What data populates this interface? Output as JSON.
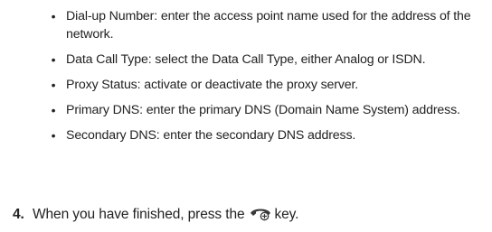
{
  "bullets": [
    "Dial-up Number: enter the access point name used for the address of the network.",
    "Data Call Type: select the Data Call Type, either Analog or ISDN.",
    "Proxy Status: activate or deactivate the proxy server.",
    "Primary DNS: enter the primary DNS (Domain Name System) address.",
    "Secondary DNS: enter the secondary DNS address."
  ],
  "bullet_glyph": "•",
  "step": {
    "number": "4.",
    "text_before": "When you have finished, press the",
    "key_icon": "end-call-key-icon",
    "text_after": "key."
  },
  "colors": {
    "text": "#222222",
    "key_icon_fill": "#3a3a3a"
  }
}
